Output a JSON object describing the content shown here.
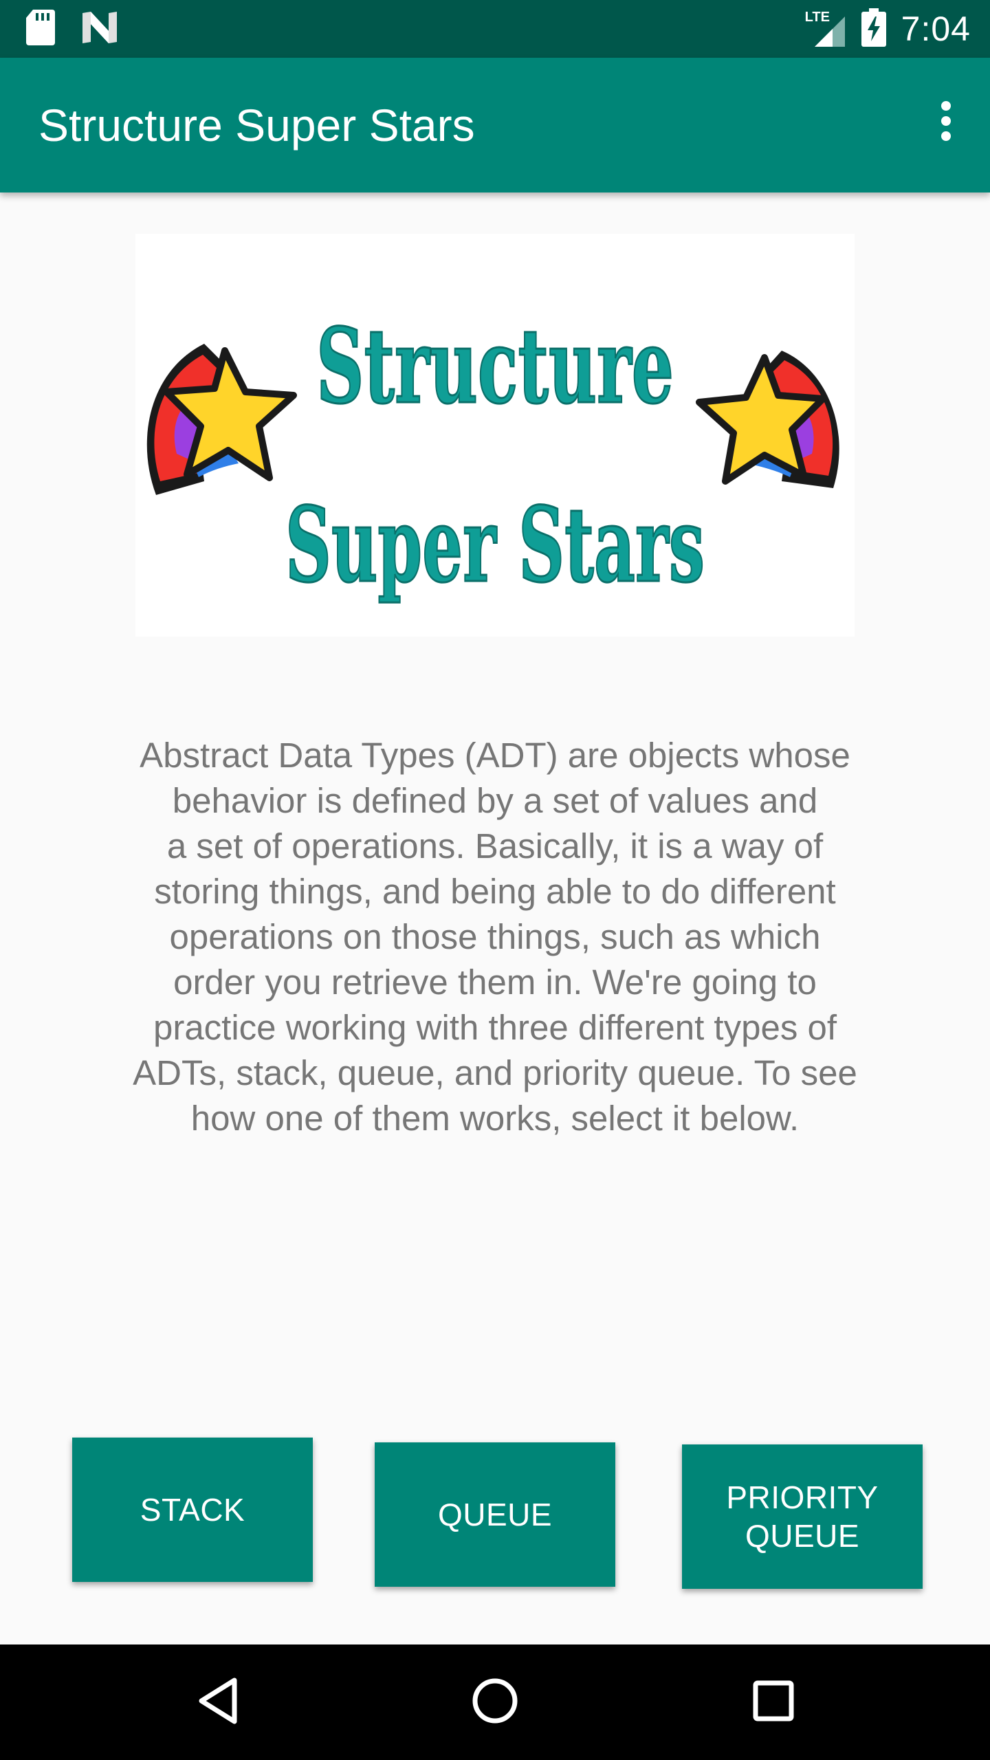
{
  "status_bar": {
    "time": "7:04",
    "network": "LTE",
    "icons": [
      "sd-card-icon",
      "n-logo-icon",
      "signal-icon",
      "battery-charging-icon"
    ]
  },
  "app_bar": {
    "title": "Structure Super Stars",
    "menu_icon": "overflow-menu-icon"
  },
  "logo": {
    "line1": "Structure",
    "line2": "Super Stars",
    "text_color": "#0f9e96"
  },
  "description": "Abstract Data Types (ADT) are objects whose\nbehavior is defined by a set of values and\na set of operations. Basically, it is a way of\nstoring things, and being able to do different\noperations on those things, such as which\norder you retrieve them in. We're going to\npractice working with three different types of\nADTs, stack, queue, and priority queue. To see\nhow one of them works, select it below.",
  "buttons": {
    "stack": "STACK",
    "queue": "QUEUE",
    "priority_queue": "PRIORITY\nQUEUE"
  },
  "nav_bar": {
    "icons": [
      "back-icon",
      "home-icon",
      "recents-icon"
    ]
  },
  "colors": {
    "status_bar": "#00574b",
    "app_bar": "#008577",
    "button": "#008577",
    "body_text": "#767676",
    "background": "#fafafa"
  }
}
